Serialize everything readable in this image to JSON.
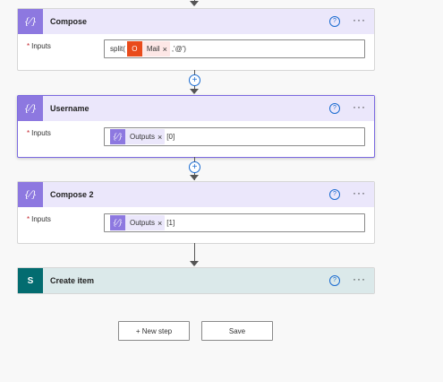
{
  "steps": [
    {
      "title": "Compose",
      "input_label": "Inputs",
      "expression_prefix": "split(",
      "token": "Mail",
      "expression_suffix": ",'@')"
    },
    {
      "title": "Username",
      "input_label": "Inputs",
      "token": "Outputs",
      "expression_suffix": "[0]"
    },
    {
      "title": "Compose 2",
      "input_label": "Inputs",
      "token": "Outputs",
      "expression_suffix": "[1]"
    },
    {
      "title": "Create item"
    }
  ],
  "buttons": {
    "new_step": "+ New step",
    "save": "Save"
  },
  "icons": {
    "compose": "curly-braces-icon",
    "office": "office-icon",
    "sharepoint": "sharepoint-icon",
    "help": "help-icon",
    "more": "more-icon",
    "add": "plus-icon"
  },
  "colors": {
    "compose_header": "#ebe7fb",
    "compose_icon": "#8d78e0",
    "sharepoint_header": "#dbe9ea",
    "sharepoint_icon": "#036c70",
    "office_icon": "#e94b1b",
    "required": "#c4262e",
    "link": "#1a6bd0"
  }
}
